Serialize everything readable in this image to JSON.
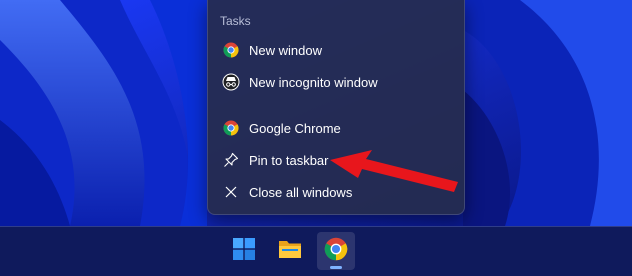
{
  "jumplist": {
    "section_title": "Tasks",
    "items": [
      {
        "label": "New window",
        "icon": "chrome-icon"
      },
      {
        "label": "New incognito window",
        "icon": "incognito-icon"
      },
      {
        "label": "Google Chrome",
        "icon": "chrome-icon"
      },
      {
        "label": "Pin to taskbar",
        "icon": "pin-icon"
      },
      {
        "label": "Close all windows",
        "icon": "close-icon"
      }
    ]
  },
  "taskbar": {
    "apps": [
      {
        "name": "Start",
        "icon": "windows-start-icon"
      },
      {
        "name": "File Explorer",
        "icon": "file-explorer-icon"
      },
      {
        "name": "Google Chrome",
        "icon": "chrome-icon",
        "active": true
      }
    ]
  },
  "colors": {
    "wallpaper_base": "#0a1a8a",
    "menu_background": "#262c4e",
    "annotation_arrow": "#e8161c",
    "accent": "#7fb2ff"
  }
}
